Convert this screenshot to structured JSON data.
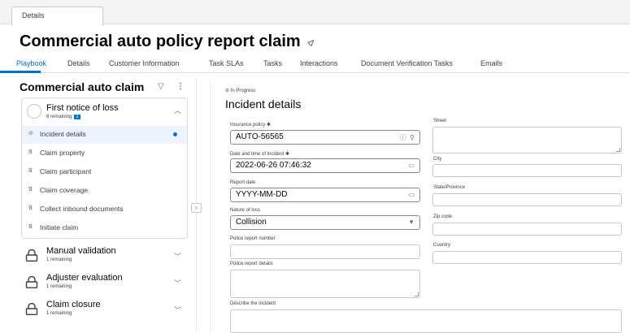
{
  "top_tab": "Details",
  "page_title": "Commercial auto policy report claim",
  "subtabs": [
    "Playbook",
    "Details",
    "Customer Information",
    "Task SLAs",
    "Tasks",
    "Interactions",
    "Document Verification Tasks",
    "Emails"
  ],
  "playbook": {
    "title": "Commercial auto claim",
    "stages": [
      {
        "name": "First notice of loss",
        "sub": "6 remaining",
        "badge": "1"
      },
      {
        "name": "Manual validation",
        "sub": "1 remaining"
      },
      {
        "name": "Adjuster evaluation",
        "sub": "1 remaining"
      },
      {
        "name": "Claim closure",
        "sub": "1 remaining"
      }
    ],
    "steps": [
      "Incident details",
      "Claim property",
      "Claim participant",
      "Claim coverage",
      "Collect inbound documents",
      "Initiate claim"
    ]
  },
  "form": {
    "status": "In Progress",
    "title": "Incident details",
    "insurance_policy_label": "Insurance policy",
    "insurance_policy_value": "AUTO-56565",
    "datetime_label": "Date and time of incident",
    "datetime_value": "2022-06-26 07:46:32",
    "report_date_label": "Report date",
    "report_date_placeholder": "YYYY-MM-DD",
    "nature_label": "Nature of loss",
    "nature_value": "Collision",
    "police_number_label": "Police report number",
    "police_details_label": "Police report details",
    "describe_label": "Describe the incident",
    "street_label": "Street",
    "city_label": "City",
    "state_label": "State/Province",
    "zip_label": "Zip code",
    "country_label": "Country",
    "required_mark": "✱"
  },
  "colors": {
    "accent": "#0070d2",
    "title": "#080707",
    "text": "#3e3e3c"
  }
}
